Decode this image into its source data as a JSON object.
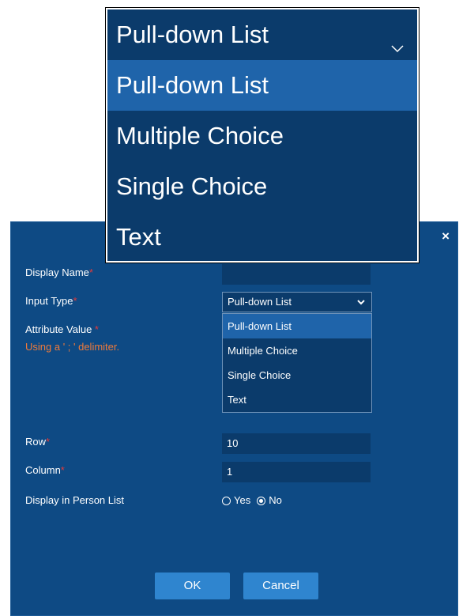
{
  "zoomed_dropdown": {
    "selected_value": "Pull-down List",
    "options": [
      "Pull-down List",
      "Multiple Choice",
      "Single Choice",
      "Text"
    ],
    "highlighted_index": 0
  },
  "dialog": {
    "close_label": "×",
    "display_name": {
      "label": "Display Name",
      "required_mark": "*",
      "value": ""
    },
    "input_type": {
      "label": "Input Type",
      "required_mark": "*",
      "selected_value": "Pull-down List",
      "options": [
        "Pull-down List",
        "Multiple Choice",
        "Single Choice",
        "Text"
      ]
    },
    "attribute_value": {
      "label": "Attribute Value ",
      "required_mark": "*",
      "note": "Using a ' ; ' delimiter."
    },
    "row": {
      "label": "Row",
      "required_mark": "*",
      "value": "10"
    },
    "column": {
      "label": "Column",
      "required_mark": "*",
      "value": "1"
    },
    "display_in_person_list": {
      "label": "Display in Person List",
      "options": [
        "Yes",
        "No"
      ],
      "selected": "No"
    },
    "ok_label": "OK",
    "cancel_label": "Cancel"
  },
  "icons": {
    "chevron": "chevron-down-icon",
    "close": "close-icon"
  },
  "colors": {
    "dialog_bg": "#0e4a84",
    "field_bg": "#0b3b6b",
    "highlight": "#1f64aa",
    "button": "#2f85cf",
    "required": "#e33a3a",
    "note": "#ef7a3a"
  }
}
